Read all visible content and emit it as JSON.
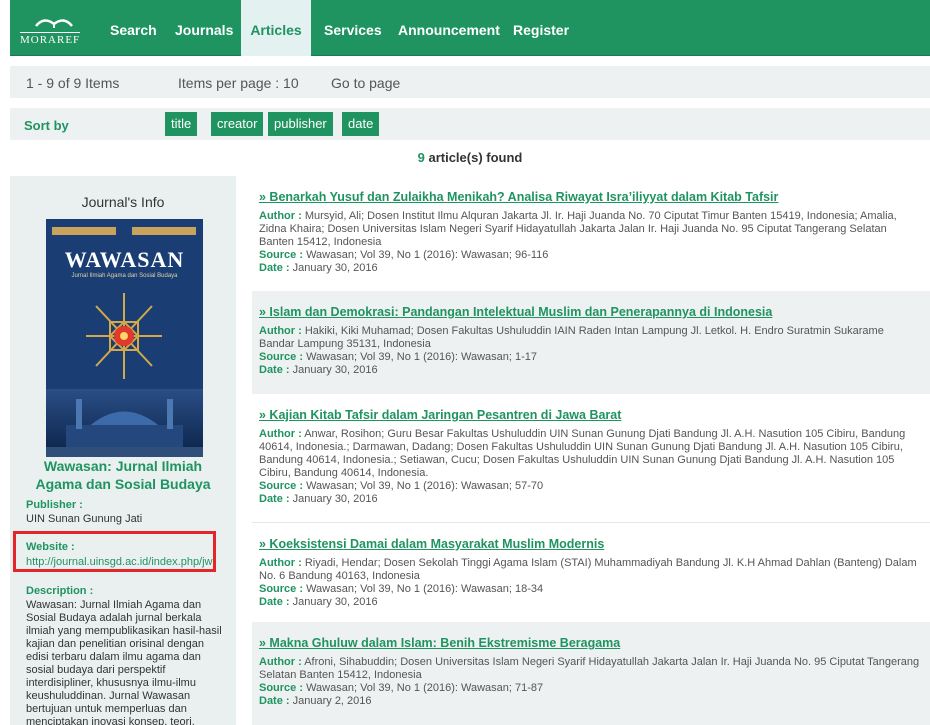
{
  "nav": {
    "logo_text": "MORAREF",
    "items": [
      "Search",
      "Journals",
      "Articles",
      "Services",
      "Announcement",
      "Register"
    ],
    "active": "Articles",
    "brand_color": "#1f9460"
  },
  "pager": {
    "range": "1 - 9 of 9 Items",
    "per_page": "Items per page : 10",
    "goto": "Go to page"
  },
  "sort": {
    "label": "Sort by",
    "options": [
      "title",
      "creator",
      "publisher",
      "date"
    ]
  },
  "found": {
    "count": "9",
    "text": "article(s) found"
  },
  "sidebar": {
    "heading": "Journal's Info",
    "cover": {
      "title": "WAWASAN",
      "subtitle": "Jurnal Ilmiah Agama dan Sosial Budaya"
    },
    "journal_title": "Wawasan: Jurnal Ilmiah Agama dan Sosial Budaya",
    "publisher_label": "Publisher :",
    "publisher": "UIN Sunan Gunung Jati",
    "website_label": "Website :",
    "website": "http://journal.uinsgd.ac.id/index.php/jw",
    "description_label": "Description :",
    "description": "Wawasan: Jurnal Ilmiah Agama dan Sosial Budaya adalah jurnal berkala ilmiah yang mempublikasikan hasil-hasil kajian dan penelitian orisinal dengan edisi terbaru dalam ilmu agama dan sosial budaya dari perspektif interdisipliner, khususnya ilmu-ilmu keushuluddinan. Jurnal Wawasan bertujuan untuk memperluas dan menciptakan inovasi konsep, teori,"
  },
  "labels": {
    "author": "Author :",
    "source": "Source :",
    "date": "Date :"
  },
  "articles": [
    {
      "title": "» Benarkah Yusuf dan Zulaikha Menikah? Analisa Riwayat Isra’iliyyat dalam Kitab Tafsir",
      "author": "Mursyid, Ali; Dosen Institut Ilmu Alquran Jakarta Jl. Ir. Haji Juanda No. 70 Ciputat Timur Banten 15419, Indonesia; Amalia, Zidna Khaira; Dosen Universitas Islam Negeri Syarif Hidayatullah Jakarta Jalan Ir. Haji Juanda No. 95 Ciputat Tangerang Selatan Banten 15412, Indonesia",
      "source": "Wawasan; Vol 39, No 1 (2016): Wawasan; 96-116",
      "date": "January 30, 2016"
    },
    {
      "title": "» Islam dan Demokrasi: Pandangan Intelektual Muslim dan Penerapannya di Indonesia",
      "author": "Hakiki, Kiki Muhamad; Dosen Fakultas Ushuluddin IAIN Raden Intan Lampung Jl. Letkol. H. Endro Suratmin Sukarame Bandar Lampung 35131, Indonesia",
      "source": "Wawasan; Vol 39, No 1 (2016): Wawasan; 1-17",
      "date": "January 30, 2016"
    },
    {
      "title": "» Kajian Kitab Tafsir dalam Jaringan Pesantren di Jawa Barat",
      "author": "Anwar, Rosihon; Guru Besar Fakultas Ushuluddin UIN Sunan Gunung Djati Bandung Jl. A.H. Nasution 105 Cibiru, Bandung 40614, Indonesia.; Darmawan, Dadang; Dosen Fakultas Ushuluddin UIN Sunan Gunung Djati Bandung Jl. A.H. Nasution 105 Cibiru, Bandung 40614, Indonesia.; Setiawan, Cucu; Dosen Fakultas Ushuluddin UIN Sunan Gunung Djati Bandung Jl. A.H. Nasution 105 Cibiru, Bandung 40614, Indonesia.",
      "source": "Wawasan; Vol 39, No 1 (2016): Wawasan; 57-70",
      "date": "January 30, 2016"
    },
    {
      "title": "» Koeksistensi Damai dalam Masyarakat Muslim Modernis",
      "author": "Riyadi, Hendar; Dosen Sekolah Tinggi Agama Islam (STAI) Muhammadiyah Bandung Jl. K.H Ahmad Dahlan (Banteng) Dalam No. 6 Bandung 40163, Indonesia",
      "source": "Wawasan; Vol 39, No 1 (2016): Wawasan; 18-34",
      "date": "January 30, 2016"
    },
    {
      "title": "» Makna Ghuluw dalam Islam: Benih Ekstremisme Beragama",
      "author": "Afroni, Sihabuddin; Dosen Universitas Islam Negeri Syarif Hidayatullah Jakarta Jalan Ir. Haji Juanda No. 95 Ciputat Tangerang Selatan Banten 15412, Indonesia",
      "source": "Wawasan; Vol 39, No 1 (2016): Wawasan; 71-87",
      "date": "January 2, 2016"
    }
  ]
}
